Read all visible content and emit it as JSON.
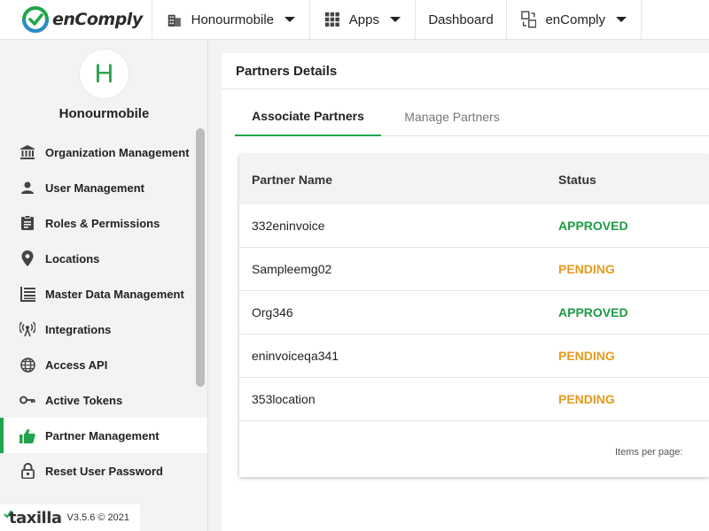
{
  "header": {
    "logo_text": "enComply",
    "org_name": "Honourmobile",
    "apps_label": "Apps",
    "dashboard_label": "Dashboard",
    "product_label": "enComply"
  },
  "sidebar": {
    "avatar_letter": "H",
    "org_name": "Honourmobile",
    "items": [
      {
        "label": "Organization Management",
        "icon": "bank-icon"
      },
      {
        "label": "User Management",
        "icon": "user-icon"
      },
      {
        "label": "Roles & Permissions",
        "icon": "clipboard-icon"
      },
      {
        "label": "Locations",
        "icon": "location-pin-icon"
      },
      {
        "label": "Master Data Management",
        "icon": "list-icon"
      },
      {
        "label": "Integrations",
        "icon": "antenna-icon"
      },
      {
        "label": "Access API",
        "icon": "globe-icon"
      },
      {
        "label": "Active Tokens",
        "icon": "key-icon"
      },
      {
        "label": "Partner Management",
        "icon": "thumbs-up-icon",
        "active": true
      },
      {
        "label": "Reset User Password",
        "icon": "lock-icon"
      }
    ],
    "footer_brand": "taxilla",
    "footer_version": "V3.5.6 © 2021"
  },
  "content": {
    "title": "Partners Details",
    "tabs": [
      {
        "label": "Associate Partners",
        "active": true
      },
      {
        "label": "Manage Partners",
        "active": false
      }
    ],
    "table": {
      "columns": [
        "Partner Name",
        "Status"
      ],
      "rows": [
        {
          "name": "332eninvoice",
          "status": "APPROVED"
        },
        {
          "name": "Sampleemg02",
          "status": "PENDING"
        },
        {
          "name": "Org346",
          "status": "APPROVED"
        },
        {
          "name": "eninvoiceqa341",
          "status": "PENDING"
        },
        {
          "name": "353location",
          "status": "PENDING"
        }
      ]
    },
    "pager": {
      "items_per_page_label": "Items per page:"
    }
  },
  "colors": {
    "accent_green": "#1fa54a",
    "approved": "#1f9a44",
    "pending": "#e59b1c"
  }
}
